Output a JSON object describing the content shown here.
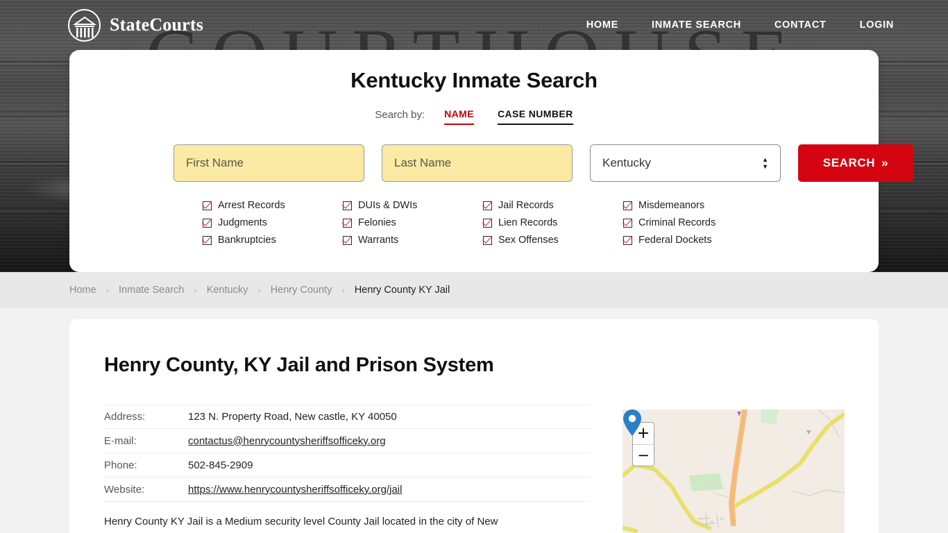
{
  "site": {
    "brand_name": "StateCourts",
    "logo_icon": "courthouse-circle-icon",
    "hero_background_word": "COURTHOUSE"
  },
  "nav": {
    "items": [
      {
        "label": "HOME"
      },
      {
        "label": "INMATE SEARCH"
      },
      {
        "label": "CONTACT"
      },
      {
        "label": "LOGIN"
      }
    ]
  },
  "search": {
    "title": "Kentucky Inmate Search",
    "search_by_label": "Search by:",
    "tabs": [
      {
        "label": "NAME",
        "active": true
      },
      {
        "label": "CASE NUMBER",
        "active": false
      }
    ],
    "first_name_placeholder": "First Name",
    "last_name_placeholder": "Last Name",
    "state_selected": "Kentucky",
    "submit_label": "SEARCH",
    "submit_chevron": "»",
    "accent_color": "#c00000",
    "button_color": "#d40511",
    "field_fill_color": "#faeaa4",
    "record_types": [
      "Arrest Records",
      "DUIs & DWIs",
      "Jail Records",
      "Misdemeanors",
      "Judgments",
      "Felonies",
      "Lien Records",
      "Criminal Records",
      "Bankruptcies",
      "Warrants",
      "Sex Offenses",
      "Federal Dockets"
    ]
  },
  "breadcrumb": {
    "separator": "›",
    "items": [
      {
        "label": "Home",
        "current": false
      },
      {
        "label": "Inmate Search",
        "current": false
      },
      {
        "label": "Kentucky",
        "current": false
      },
      {
        "label": "Henry County",
        "current": false
      },
      {
        "label": "Henry County KY Jail",
        "current": true
      }
    ]
  },
  "main": {
    "page_title": "Henry County, KY Jail and Prison System",
    "details": [
      {
        "label": "Address:",
        "value": "123 N. Property Road, New castle, KY 40050",
        "link": false
      },
      {
        "label": "E-mail:",
        "value": "contactus@henrycountysheriffsofficeky.org",
        "link": true
      },
      {
        "label": "Phone:",
        "value": "502-845-2909",
        "link": false
      },
      {
        "label": "Website:",
        "value": "https://www.henrycountysheriffsofficeky.org/jail",
        "link": true
      }
    ],
    "description": "Henry County KY Jail is a Medium security level County Jail located in the city of New"
  },
  "map": {
    "zoom_in_label": "+",
    "zoom_out_label": "−",
    "marker_icon": "location-pin-icon",
    "marker_color": "#2a7fc9"
  }
}
